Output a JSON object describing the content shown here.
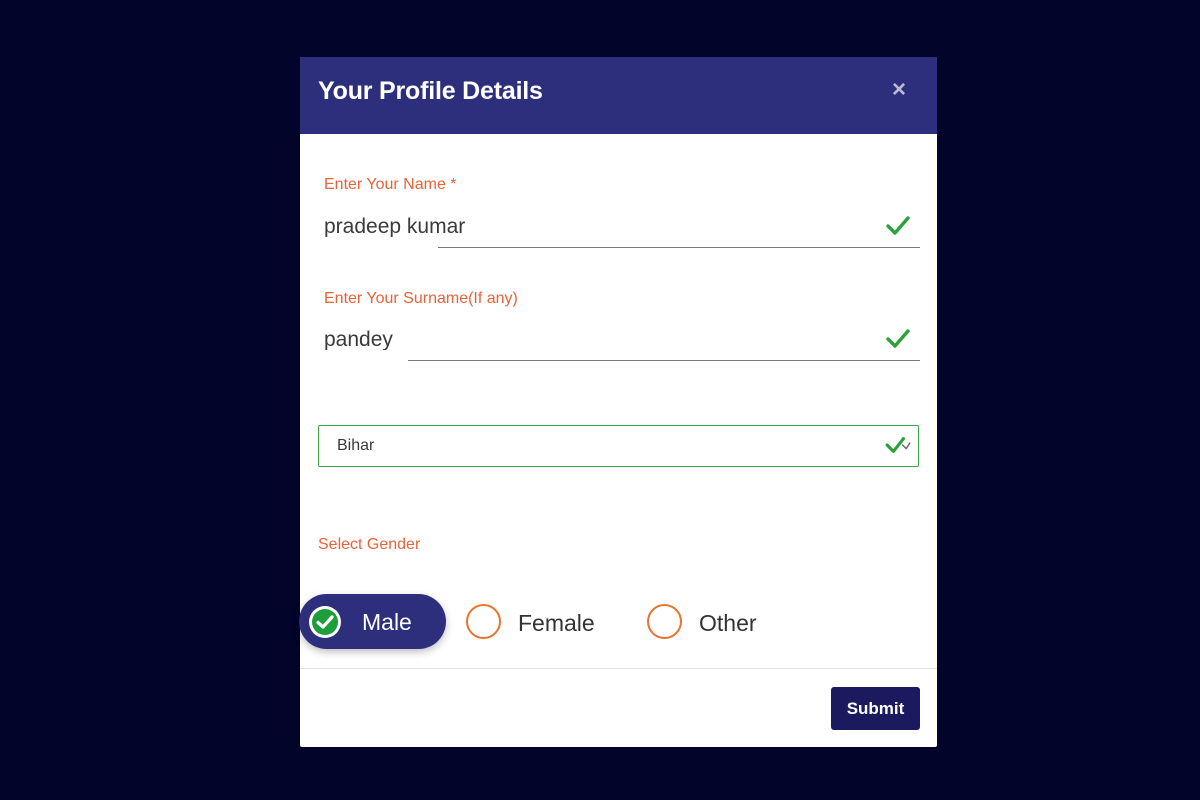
{
  "modal": {
    "title": "Your Profile Details",
    "close_icon": "close-icon"
  },
  "form": {
    "name": {
      "label": "Enter Your Name *",
      "value": "pradeep kumar",
      "status_icon": "check-icon"
    },
    "surname": {
      "label": "Enter Your Surname(If any)",
      "value": "pandey",
      "status_icon": "check-icon"
    },
    "state": {
      "value": "Bihar",
      "status_icon": "check-icon"
    },
    "gender": {
      "label": "Select Gender",
      "options": [
        {
          "label": "Male",
          "selected": true
        },
        {
          "label": "Female",
          "selected": false
        },
        {
          "label": "Other",
          "selected": false
        }
      ]
    },
    "submit_label": "Submit"
  },
  "colors": {
    "header_bg": "#2d2f7d",
    "page_bg": "#03042a",
    "label_accent": "#e8633a",
    "valid_green": "#3aa845",
    "radio_outline": "#e8742f",
    "submit_bg": "#1c1a5e"
  }
}
